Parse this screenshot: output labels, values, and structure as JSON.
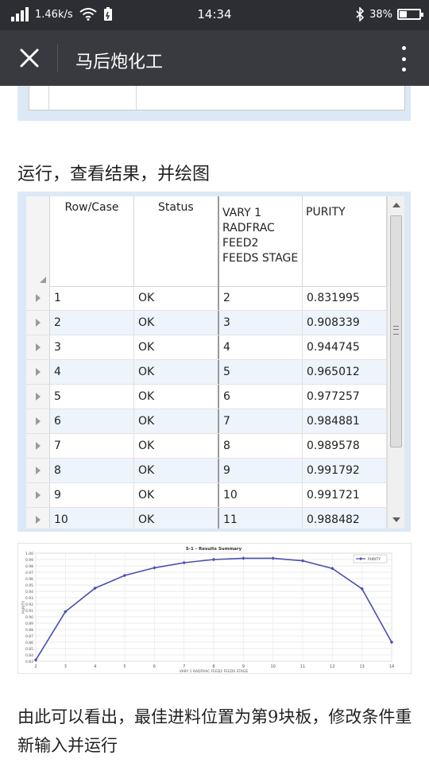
{
  "status_bar": {
    "speed": "1.46k/s",
    "time": "14:34",
    "battery": "38%",
    "battery_level": 0.38
  },
  "app_bar": {
    "title": "马后炮化工"
  },
  "captions": {
    "run": "运行，查看结果，并绘图",
    "conclusion": "由此可以看出，最佳进料位置为第9块板，修改条件重新输入并运行"
  },
  "results_table": {
    "headers": {
      "row_case": "Row/Case",
      "status": "Status",
      "vary": "VARY  1\nRADFRAC\nFEED2\nFEEDS  STAGE",
      "purity": "PURITY"
    },
    "rows": [
      {
        "case": "1",
        "status": "OK",
        "stage": "2",
        "purity": "0.831995"
      },
      {
        "case": "2",
        "status": "OK",
        "stage": "3",
        "purity": "0.908339"
      },
      {
        "case": "3",
        "status": "OK",
        "stage": "4",
        "purity": "0.944745"
      },
      {
        "case": "4",
        "status": "OK",
        "stage": "5",
        "purity": "0.965012"
      },
      {
        "case": "5",
        "status": "OK",
        "stage": "6",
        "purity": "0.977257"
      },
      {
        "case": "6",
        "status": "OK",
        "stage": "7",
        "purity": "0.984881"
      },
      {
        "case": "7",
        "status": "OK",
        "stage": "8",
        "purity": "0.989578"
      },
      {
        "case": "8",
        "status": "OK",
        "stage": "9",
        "purity": "0.991792"
      },
      {
        "case": "9",
        "status": "OK",
        "stage": "10",
        "purity": "0.991721"
      },
      {
        "case": "10",
        "status": "OK",
        "stage": "11",
        "purity": "0.988482"
      }
    ]
  },
  "chart_data": {
    "type": "line",
    "title": "S-1 - Results Summary",
    "xlabel": "VARY 1 RADFRAC FEED2 FEEDS STAGE",
    "ylabel": "PURITY",
    "legend": "top-right",
    "x_ticks": [
      "2",
      "3",
      "4",
      "5",
      "6",
      "7",
      "8",
      "9",
      "10",
      "11",
      "12",
      "13",
      "14"
    ],
    "y_ticks": [
      "0.83",
      "0.84",
      "0.85",
      "0.86",
      "0.87",
      "0.88",
      "0.89",
      "0.90",
      "0.91",
      "0.92",
      "0.93",
      "0.94",
      "0.95",
      "0.96",
      "0.97",
      "0.98",
      "0.99",
      "1.00"
    ],
    "xlim": [
      2,
      14
    ],
    "ylim": [
      0.83,
      1.0
    ],
    "grid": true,
    "series": [
      {
        "name": "PURITY",
        "color": "#4a4fb0",
        "x": [
          2,
          3,
          4,
          5,
          6,
          7,
          8,
          9,
          10,
          11,
          12,
          13,
          14
        ],
        "y": [
          0.832,
          0.908,
          0.945,
          0.965,
          0.977,
          0.985,
          0.99,
          0.992,
          0.992,
          0.988,
          0.976,
          0.944,
          0.86
        ]
      }
    ]
  }
}
